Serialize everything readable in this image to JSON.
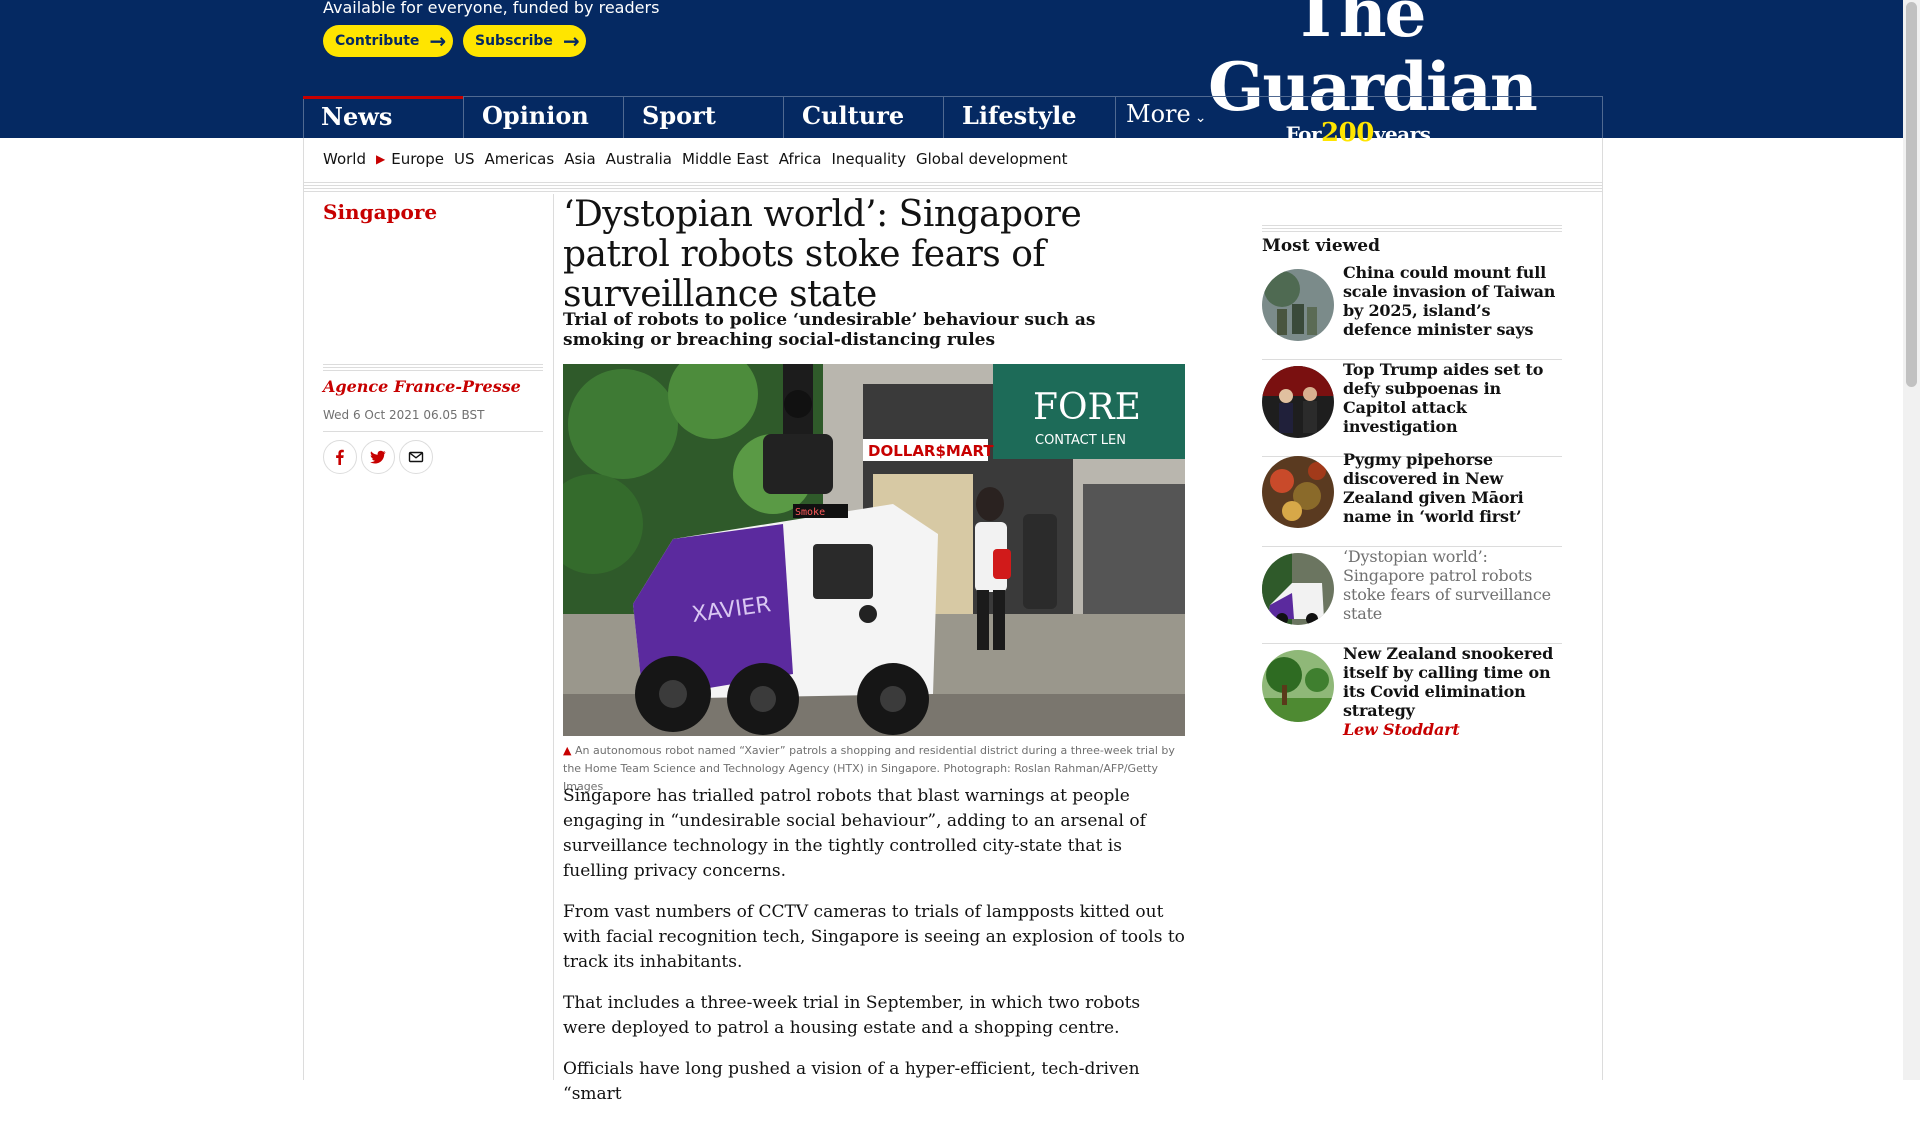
{
  "header": {
    "support_text": "Available for everyone, funded by readers",
    "contribute_label": "Contribute",
    "subscribe_label": "Subscribe",
    "logo_word": "The Guardian",
    "logo_tagline_pre": "For",
    "logo_tagline_num": "200",
    "logo_tagline_post": "years"
  },
  "nav": {
    "pillars": [
      "News",
      "Opinion",
      "Sport",
      "Culture",
      "Lifestyle"
    ],
    "more_label": "More"
  },
  "subnav": {
    "items": [
      "World",
      "Europe",
      "US",
      "Americas",
      "Asia",
      "Australia",
      "Middle East",
      "Africa",
      "Inequality",
      "Global development"
    ]
  },
  "article": {
    "section": "Singapore",
    "byline": "Agence France-Presse",
    "date": "Wed 6 Oct 2021 06.05 BST",
    "headline": "‘Dystopian world’: Singapore patrol robots stoke fears of surveillance state",
    "standfirst": "Trial of robots to police ‘undesirable’ behaviour such as smoking or breaching social-distancing rules",
    "image_labels": {
      "robot_name": "XAVIER",
      "robot_screen": "Smoke",
      "shop_sign": "FORE",
      "shop_sign_sub": "CONTACT LEN",
      "store_sign": "DOLLAR$MART"
    },
    "caption": "An autonomous robot named “Xavier” patrols a shopping and residential district during a three-week trial by the Home Team Science and Technology Agency (HTX) in Singapore. Photograph: Roslan Rahman/AFP/Getty Images",
    "paragraphs": [
      "Singapore has trialled patrol robots that blast warnings at people engaging in “undesirable social behaviour”, adding to an arsenal of surveillance technology in the tightly controlled city-state that is fuelling privacy concerns.",
      "From vast numbers of CCTV cameras to trials of lampposts kitted out with facial recognition tech, Singapore is seeing an explosion of tools to track its inhabitants.",
      "That includes a three-week trial in September, in which two robots were deployed to patrol a housing estate and a shopping centre.",
      "Officials have long pushed a vision of a hyper-efficient, tech-driven “smart"
    ]
  },
  "most_viewed": {
    "title": "Most viewed",
    "items": [
      {
        "headline": "China could mount full scale invasion of Taiwan by 2025, island’s defence minister says"
      },
      {
        "headline": "Top Trump aides set to defy subpoenas in Capitol attack investigation"
      },
      {
        "headline": "Pygmy pipehorse discovered in New Zealand given Māori name in ‘world first’"
      },
      {
        "headline": "‘Dystopian world’: Singapore patrol robots stoke fears of surveillance state"
      },
      {
        "headline": "New Zealand snookered itself by calling time on its Covid elimination strategy",
        "author": "Lew Stoddart"
      }
    ]
  },
  "colors": {
    "brand_blue": "#052962",
    "accent_red": "#c70000",
    "highlight_yellow": "#ffe500",
    "robot_purple": "#5b2a9e"
  }
}
